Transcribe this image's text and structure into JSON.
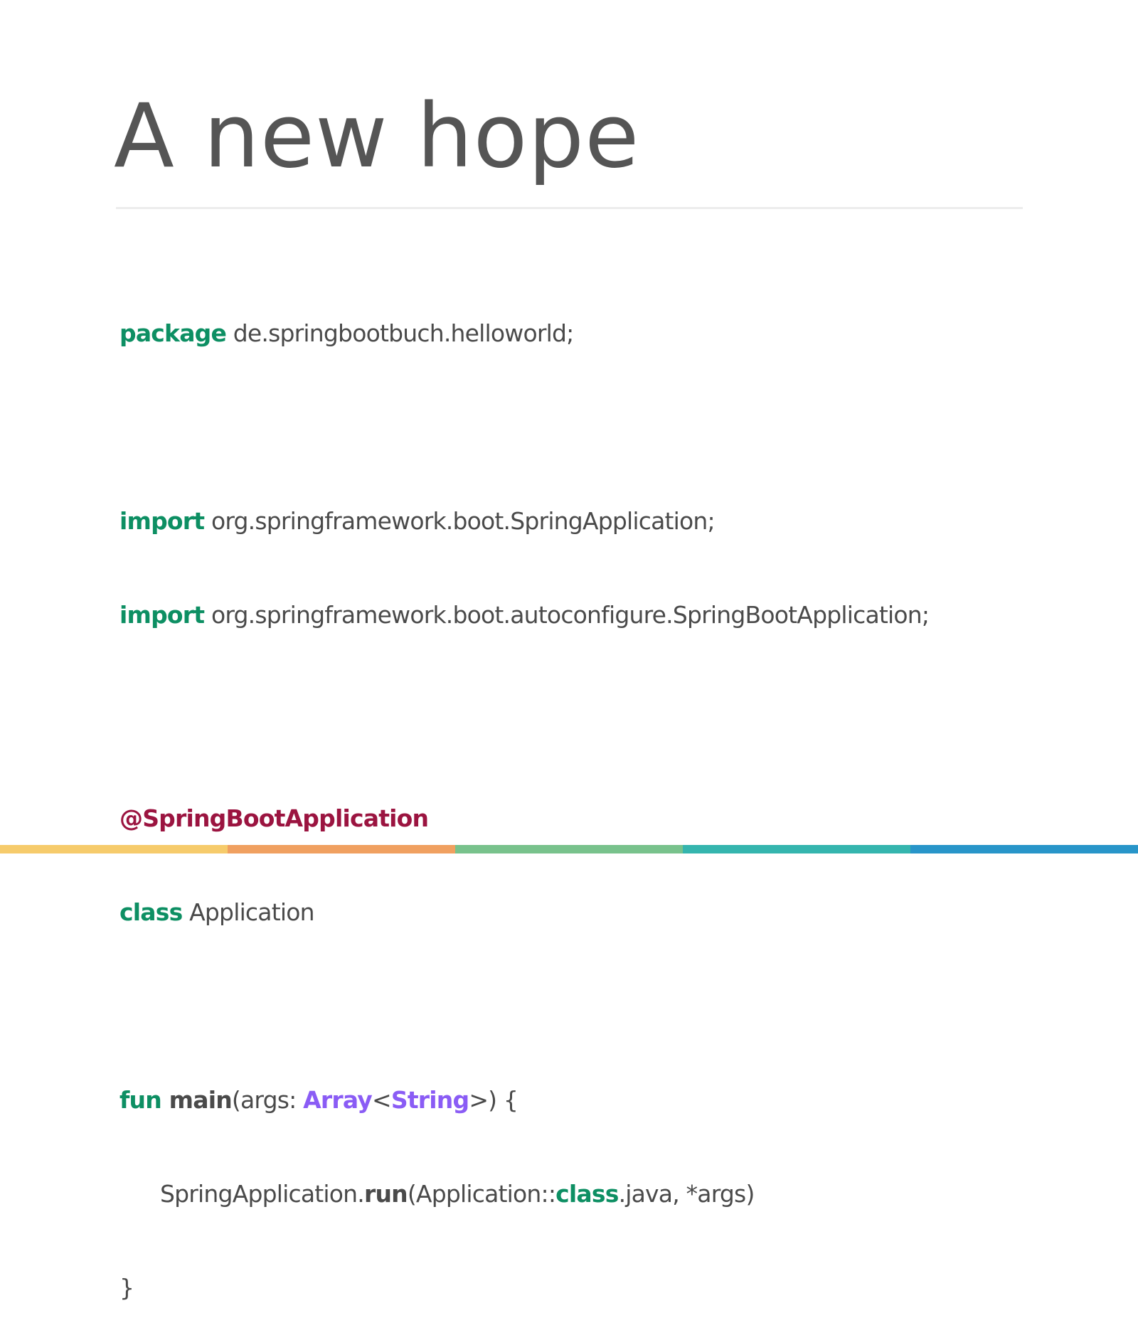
{
  "slide": {
    "title": "A new hope"
  },
  "code": {
    "package_kw": "package",
    "package_name": " de.springbootbuch.helloworld;",
    "import1_kw": "import",
    "import1_path": " org.springframework.boot.SpringApplication;",
    "import2_kw": "import",
    "import2_path": " org.springframework.boot.autoconfigure.SpringBootApplication;",
    "annotation": "@SpringBootApplication",
    "class_kw": "class",
    "class_name": " Application",
    "fun_kw": "fun",
    "fun_name": " main",
    "fun_params_open": "(args: ",
    "type_array": "Array",
    "lt": "<",
    "type_string": "String",
    "fun_params_close": ">) {",
    "call_receiver": "SpringApplication.",
    "call_name": "run",
    "call_args_open": "(Application::",
    "call_class_kw": "class",
    "call_args_close": ".java, *args)",
    "close_brace": "}"
  },
  "colors": {
    "keyword": "#0d8f63",
    "annotation": "#9b1440",
    "type": "#8a5cf5",
    "text": "#4a4a4a",
    "title": "#555555",
    "bar": [
      "#f6cb6b",
      "#f0a060",
      "#78c28c",
      "#35b5ae",
      "#2895c9"
    ]
  }
}
